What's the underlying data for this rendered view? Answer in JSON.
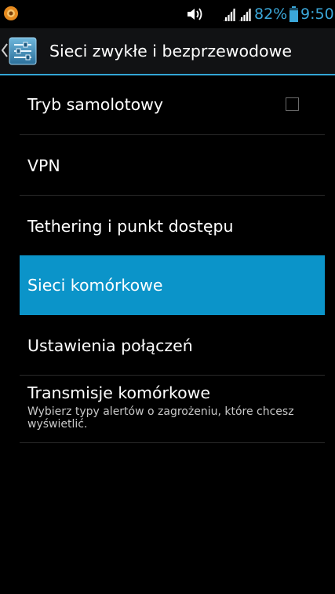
{
  "status_bar": {
    "app_icon": "notification-app-icon",
    "volume_icon": "volume-icon",
    "signal_icon": "cellular-signal-icon",
    "battery_percent": "82%",
    "battery_level": 0.82,
    "time": "9:50",
    "accent_color": "#3ba7d9"
  },
  "action_bar": {
    "title": "Sieci zwykłe i bezprzewodowe",
    "icon": "wireless-settings-icon",
    "up_icon": "chevron-left-icon",
    "divider_color": "#33a6d6"
  },
  "list": {
    "items": [
      {
        "title": "Tryb samolotowy",
        "checked": false
      },
      {
        "title": "VPN"
      },
      {
        "title": "Tethering i punkt dostępu"
      },
      {
        "title": "Sieci komórkowe",
        "selected": true
      },
      {
        "title": "Ustawienia połączeń"
      },
      {
        "title": "Transmisje komórkowe",
        "subtitle": "Wybierz typy alertów o zagrożeniu, które chcesz wyświetlić."
      }
    ],
    "selected_color": "#0b94c9"
  }
}
